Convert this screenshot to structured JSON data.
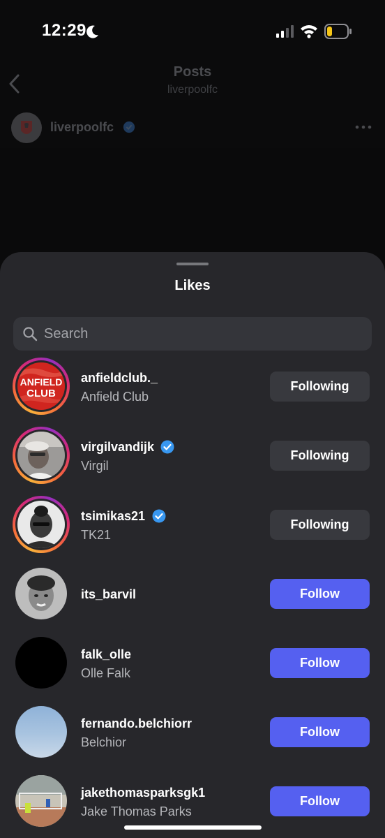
{
  "status_bar": {
    "time": "12:29"
  },
  "header": {
    "title": "Posts",
    "subtitle": "liverpoolfc"
  },
  "post": {
    "username": "liverpoolfc"
  },
  "sheet": {
    "title": "Likes",
    "search": {
      "placeholder": "Search"
    }
  },
  "likes": [
    {
      "username": "anfieldclub._",
      "full_name": "Anfield Club",
      "verified": false,
      "button": "Following"
    },
    {
      "username": "virgilvandijk",
      "full_name": "Virgil",
      "verified": true,
      "button": "Following"
    },
    {
      "username": "tsimikas21",
      "full_name": "TK21",
      "verified": true,
      "button": "Following"
    },
    {
      "username": "its_barvil",
      "full_name": "",
      "verified": false,
      "button": "Follow"
    },
    {
      "username": "falk_olle",
      "full_name": "Olle Falk",
      "verified": false,
      "button": "Follow"
    },
    {
      "username": "fernando.belchiorr",
      "full_name": "Belchior",
      "verified": false,
      "button": "Follow"
    },
    {
      "username": "jakethomasparksgk1",
      "full_name": "Jake Thomas Parks",
      "verified": false,
      "button": "Follow"
    }
  ],
  "avatar_texts": {
    "anfield_logo": "ANFIELD CLUB"
  },
  "colors": {
    "follow_button": "#5560f0",
    "following_button": "#38393e",
    "verified": "#3897f0"
  }
}
